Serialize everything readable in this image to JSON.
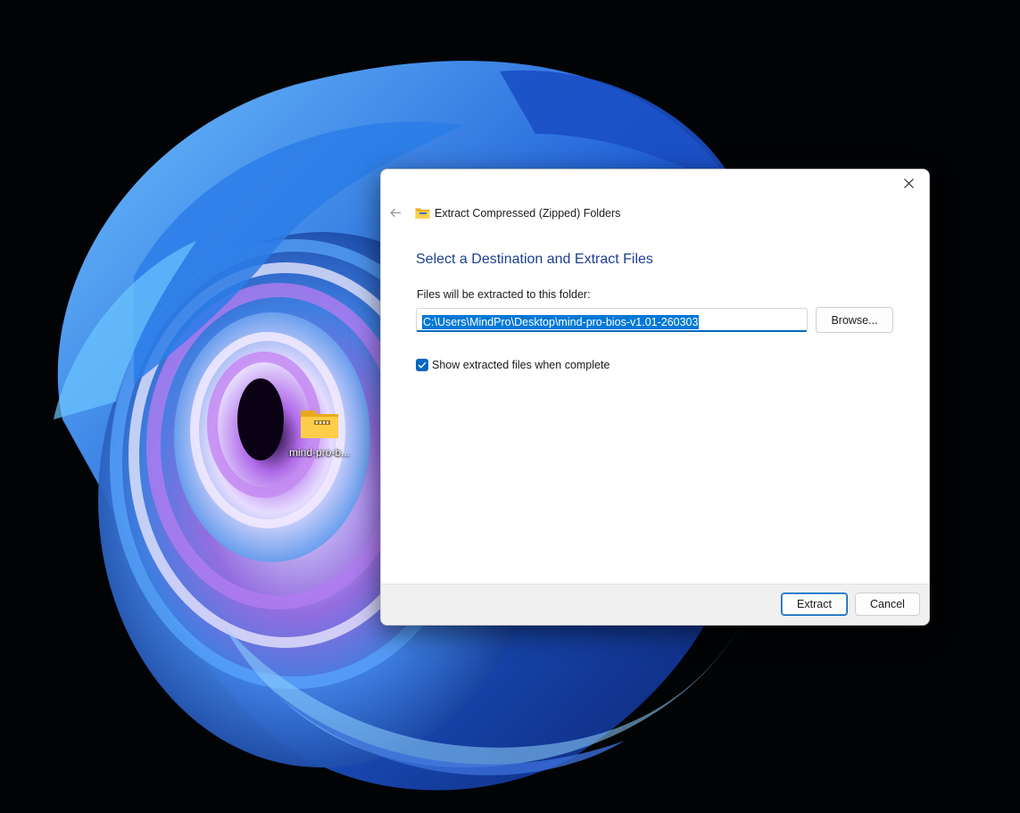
{
  "desktop": {
    "icons": [
      {
        "label": "mind-pro-b...",
        "icon": "zip-folder-icon"
      }
    ]
  },
  "dialog": {
    "title": "Extract Compressed (Zipped) Folders",
    "heading": "Select a Destination and Extract Files",
    "folder_label": "Files will be extracted to this folder:",
    "path_value": "C:\\Users\\MindPro\\Desktop\\mind-pro-bios-v1.01-260303",
    "browse_label": "Browse...",
    "checkbox": {
      "label": "Show extracted files when complete",
      "checked": true
    },
    "extract_label": "Extract",
    "cancel_label": "Cancel",
    "close_icon": "close-icon",
    "back_icon": "back-arrow-icon"
  },
  "colors": {
    "accent": "#0067c0",
    "heading": "#1c3f94",
    "selection": "#0078d7",
    "footer": "#f0f0f0"
  }
}
